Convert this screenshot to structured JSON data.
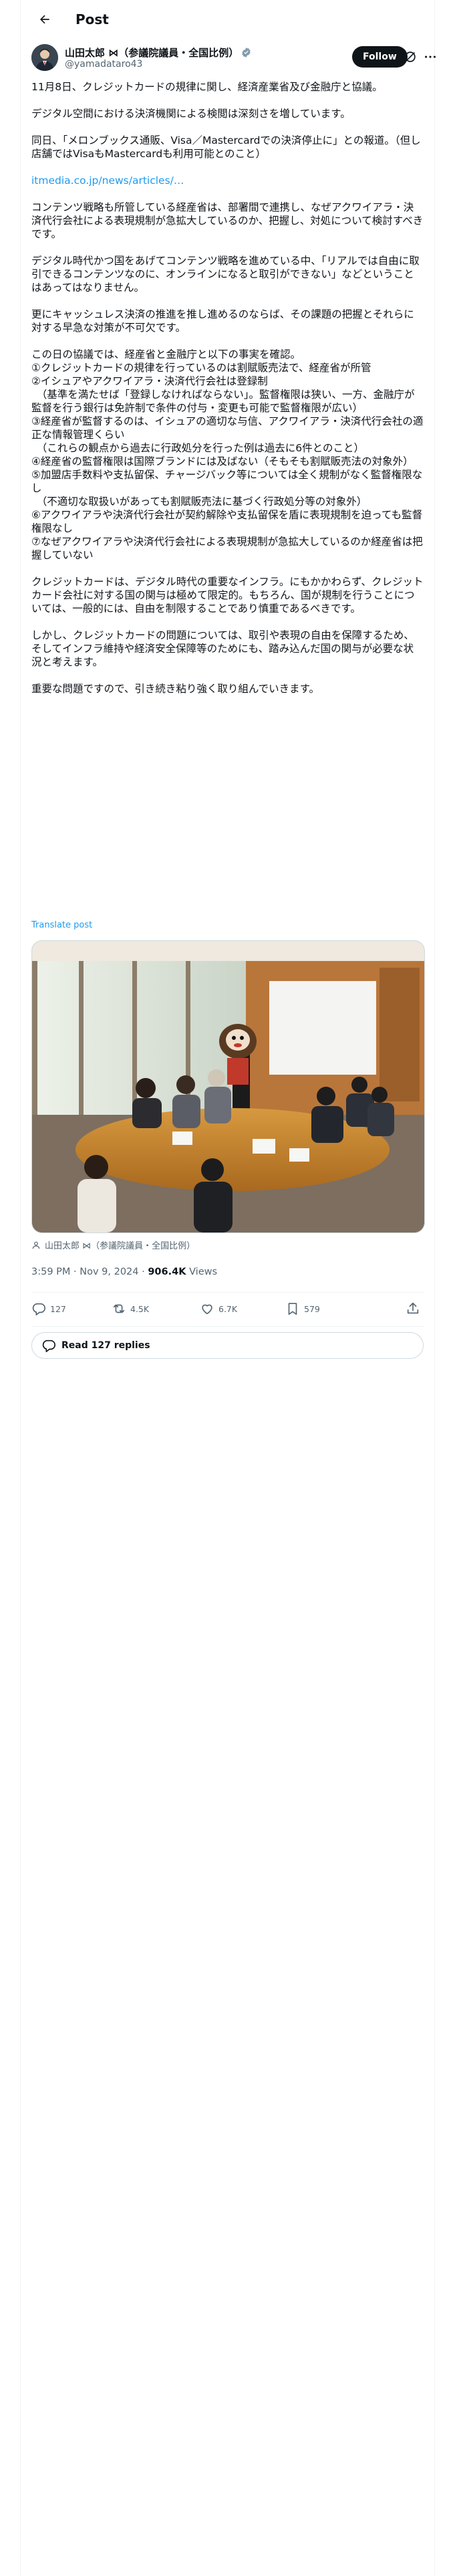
{
  "header": {
    "title": "Post"
  },
  "author": {
    "name": "山田太郎 ⋈（参議院議員・全国比例）",
    "handle": "@yamadataro43",
    "follow_label": "Follow"
  },
  "post": {
    "text_p1": "11月8日、クレジットカードの規律に関し、経済産業省及び金融庁と協議。\n\nデジタル空間における決済機関による検閲は深刻さを増しています。\n\n同日、「メロンブックス通販、Visa／Mastercardでの決済停止に」との報道。（但し店舗ではVisaもMastercardも利用可能とのこと）\n\n",
    "link": "itmedia.co.jp/news/articles/…",
    "text_p2": "\n\nコンテンツ戦略も所管している経産省は、部署間で連携し、なぜアクワイアラ・決済代行会社による表現規制が急拡大しているのか、把握し、対処について検討すべきです。\n\nデジタル時代かつ国をあげてコンテンツ戦略を進めている中、「リアルでは自由に取引できるコンテンツなのに、オンラインになると取引ができない」などということはあってはなりません。\n\n更にキャッシュレス決済の推進を推し進めるのならば、その課題の把握とそれらに対する早急な対策が不可欠です。\n\nこの日の協議では、経産省と金融庁と以下の事実を確認。\n①クレジットカードの規律を行っているのは割賦販売法で、経産省が所管\n②イシュアやアクワイアラ・決済代行会社は登録制\n　（基準を満たせば「登録しなければならない」。監督権限は狭い、一方、金融庁が監督を行う銀行は免許制で条件の付与・変更も可能で監督権限が広い）\n③経産省が監督するのは、イシュアの適切な与信、アクワイアラ・決済代行会社の適正な情報管理くらい\n　（これらの観点から過去に行政処分を行った例は過去に6件とのこと）\n④経産省の監督権限は国際ブランドには及ばない（そもそも割賦販売法の対象外）\n⑤加盟店手数料や支払留保、チャージバック等については全く規制がなく監督権限なし\n　（不適切な取扱いがあっても割賦販売法に基づく行政処分等の対象外）\n⑥アクワイアラや決済代行会社が契約解除や支払留保を盾に表現規制を迫っても監督権限なし\n⑦なぜアクワイアラや決済代行会社による表現規制が急拡大しているのか経産省は把握していない\n\nクレジットカードは、デジタル時代の重要なインフラ。にもかかわらず、クレジットカード会社に対する国の関与は極めて限定的。もちろん、国が規制を行うことについては、一般的には、自由を制限することであり慎重であるべきです。\n\nしかし、クレジットカードの問題については、取引や表現の自由を保障するため、そしてインフラ維持や経済安全保障等のためにも、踏み込んだ国の関与が必要な状況と考えます。\n\n重要な問題ですので、引き続き粘り強く取り組んでいきます。",
    "translate_label": "Translate post",
    "photo_tag": "山田太郎 ⋈（参議院議員・全国比例）",
    "time": "3:59 PM · Nov 9, 2024",
    "views_count": "906.4K",
    "views_label": "Views"
  },
  "actions": {
    "replies": "127",
    "reposts": "4.5K",
    "likes": "6.7K",
    "bookmarks": "579"
  },
  "read_replies_label": "Read 127 replies",
  "colors": {
    "accent": "#1d9bf0",
    "text": "#0f1419",
    "muted": "#536471"
  }
}
